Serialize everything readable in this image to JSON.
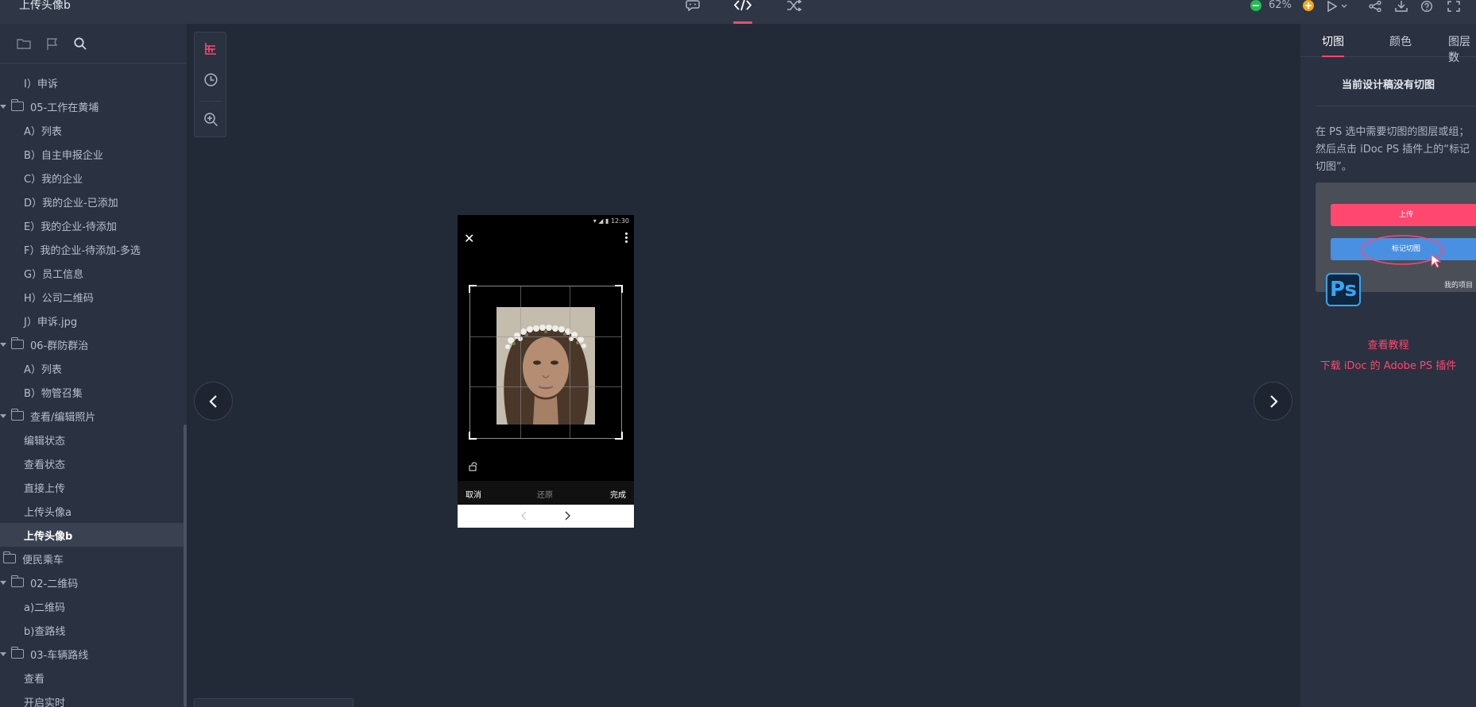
{
  "header": {
    "title": "上传头像b",
    "zoom": "62%"
  },
  "sidebar": {
    "items": [
      {
        "label": "I）申诉",
        "type": "page"
      },
      {
        "label": "05-工作在黄埔",
        "type": "folder"
      },
      {
        "label": "A）列表",
        "type": "page"
      },
      {
        "label": "B）自主申报企业",
        "type": "page"
      },
      {
        "label": "C）我的企业",
        "type": "page"
      },
      {
        "label": "D）我的企业-已添加",
        "type": "page"
      },
      {
        "label": "E）我的企业-待添加",
        "type": "page"
      },
      {
        "label": "F）我的企业-待添加-多选",
        "type": "page"
      },
      {
        "label": "G）员工信息",
        "type": "page"
      },
      {
        "label": "H）公司二维码",
        "type": "page"
      },
      {
        "label": "J）申诉.jpg",
        "type": "page"
      },
      {
        "label": "06-群防群治",
        "type": "folder"
      },
      {
        "label": "A）列表",
        "type": "page"
      },
      {
        "label": "B）物管召集",
        "type": "page"
      },
      {
        "label": "查看/编辑照片",
        "type": "folder"
      },
      {
        "label": "编辑状态",
        "type": "page"
      },
      {
        "label": "查看状态",
        "type": "page"
      },
      {
        "label": "直接上传",
        "type": "page"
      },
      {
        "label": "上传头像a",
        "type": "page"
      },
      {
        "label": "上传头像b",
        "type": "page",
        "active": true
      },
      {
        "label": "便民乘车",
        "type": "root-folder"
      },
      {
        "label": "02-二维码",
        "type": "folder"
      },
      {
        "label": "a)二维码",
        "type": "page"
      },
      {
        "label": "b)查路线",
        "type": "page"
      },
      {
        "label": "03-车辆路线",
        "type": "folder"
      },
      {
        "label": "查看",
        "type": "page"
      },
      {
        "label": "开启实时",
        "type": "page"
      }
    ]
  },
  "phone": {
    "time": "12:30",
    "cancel": "取消",
    "restore": "还原",
    "done": "完成"
  },
  "right_panel": {
    "tabs": [
      "切图",
      "颜色",
      "图层数"
    ],
    "heading": "当前设计稿没有切图",
    "desc_lines": [
      "在 PS 选中需要切图的图层或组；",
      "然后点击 iDoc PS 插件上的“标记",
      "切图”。"
    ],
    "demo": {
      "upload": "上传",
      "mark": "标记切图",
      "project": "我的项目"
    },
    "ps_logo": "Ps",
    "link_tutorial": "查看教程",
    "link_download": "下载 iDoc 的 Adobe PS 插件"
  },
  "colors": {
    "accent": "#ff4770",
    "bg": "#232a37",
    "panel": "#2a3140"
  },
  "icons": [
    "comment-icon",
    "code-icon",
    "shuffle-icon",
    "play-icon",
    "share-icon",
    "download-icon",
    "help-icon",
    "fullscreen-icon",
    "folder-icon",
    "flag-icon",
    "search-icon",
    "layers-icon",
    "history-icon",
    "zoom-icon"
  ]
}
